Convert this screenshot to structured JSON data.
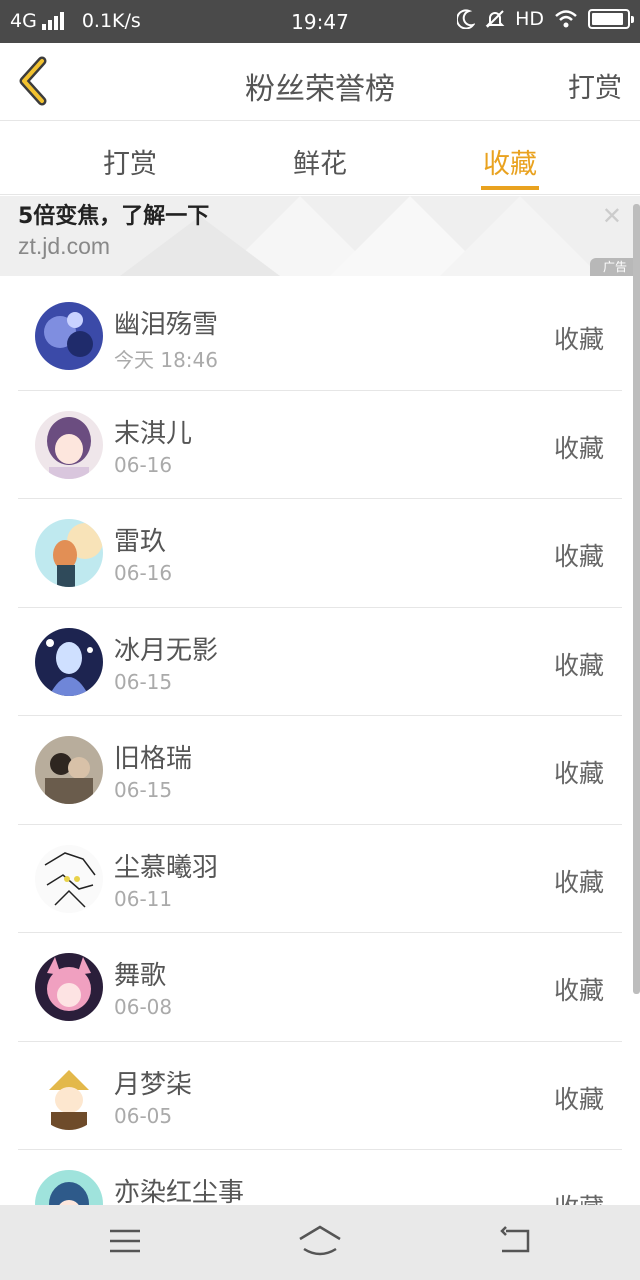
{
  "status_bar": {
    "network": "4G",
    "speed": "0.1K/s",
    "time": "19:47",
    "hd": "HD"
  },
  "header": {
    "title": "粉丝荣誉榜",
    "right_action": "打赏"
  },
  "tabs": [
    {
      "label": "打赏",
      "active": false
    },
    {
      "label": "鲜花",
      "active": false
    },
    {
      "label": "收藏",
      "active": true
    }
  ],
  "ad": {
    "headline": "5倍变焦，了解一下",
    "domain": "zt.jd.com",
    "badge": "广告"
  },
  "list": [
    {
      "name": "幽泪殇雪",
      "date": "今天 18:46",
      "status": "收藏",
      "avatar_color": "#3b4aa8"
    },
    {
      "name": "末淇儿",
      "date": "06-16",
      "status": "收藏",
      "avatar_color": "#7b5a8f"
    },
    {
      "name": "雷玖",
      "date": "06-16",
      "status": "收藏",
      "avatar_color": "#e2a36f"
    },
    {
      "name": "冰月无影",
      "date": "06-15",
      "status": "收藏",
      "avatar_color": "#2c3b6e"
    },
    {
      "name": "旧格瑞",
      "date": "06-15",
      "status": "收藏",
      "avatar_color": "#6e5f52"
    },
    {
      "name": "尘慕曦羽",
      "date": "06-11",
      "status": "收藏",
      "avatar_color": "#dcdcdc"
    },
    {
      "name": "舞歌",
      "date": "06-08",
      "status": "收藏",
      "avatar_color": "#e58fae"
    },
    {
      "name": "月梦柒",
      "date": "06-05",
      "status": "收藏",
      "avatar_color": "#c99a3a"
    },
    {
      "name": "亦染红尘事",
      "date": "",
      "status": "收藏",
      "avatar_color": "#5cc6c0"
    }
  ],
  "colors": {
    "accent": "#e9a21f",
    "status_bar": "#4a4a4a",
    "divider": "#e6e6e6"
  }
}
